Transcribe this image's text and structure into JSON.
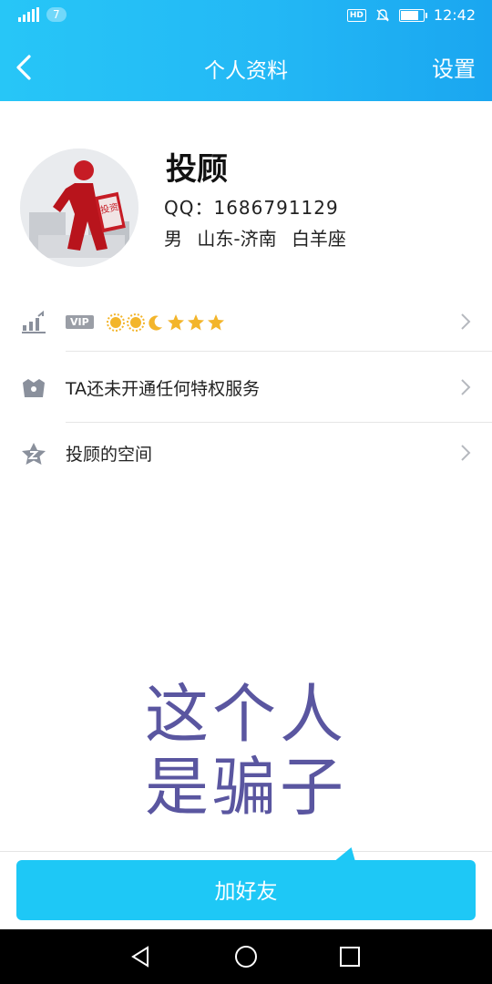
{
  "status_bar": {
    "network": "4G",
    "notification_count": "7",
    "hd_label": "HD",
    "time": "12:42",
    "battery_level": 0.85
  },
  "nav": {
    "title": "个人资料",
    "settings_label": "设置",
    "back_icon": "chevron-left-icon"
  },
  "profile": {
    "name": "投顾",
    "qq_line": "QQ：1686791129",
    "gender": "男",
    "location": "山东-济南",
    "zodiac": "白羊座",
    "avatar_sign_text": "投资"
  },
  "rows": [
    {
      "icon": "level-chart-icon",
      "label": "VIP",
      "badges": [
        "sun-icon",
        "sun-icon",
        "moon-icon",
        "star-icon",
        "star-icon",
        "star-icon"
      ]
    },
    {
      "icon": "crown-icon",
      "label": "TA还未开通任何特权服务"
    },
    {
      "icon": "space-star-icon",
      "label": "投顾的空间"
    }
  ],
  "overlay_text": [
    "这个人",
    "是骗子"
  ],
  "actions": {
    "add_friend_label": "加好友"
  },
  "colors": {
    "header_blue": "#23b8f5",
    "button_blue": "#1ec8f6",
    "overlay_purple": "#5a56a0",
    "icon_gray": "#8a909c"
  }
}
